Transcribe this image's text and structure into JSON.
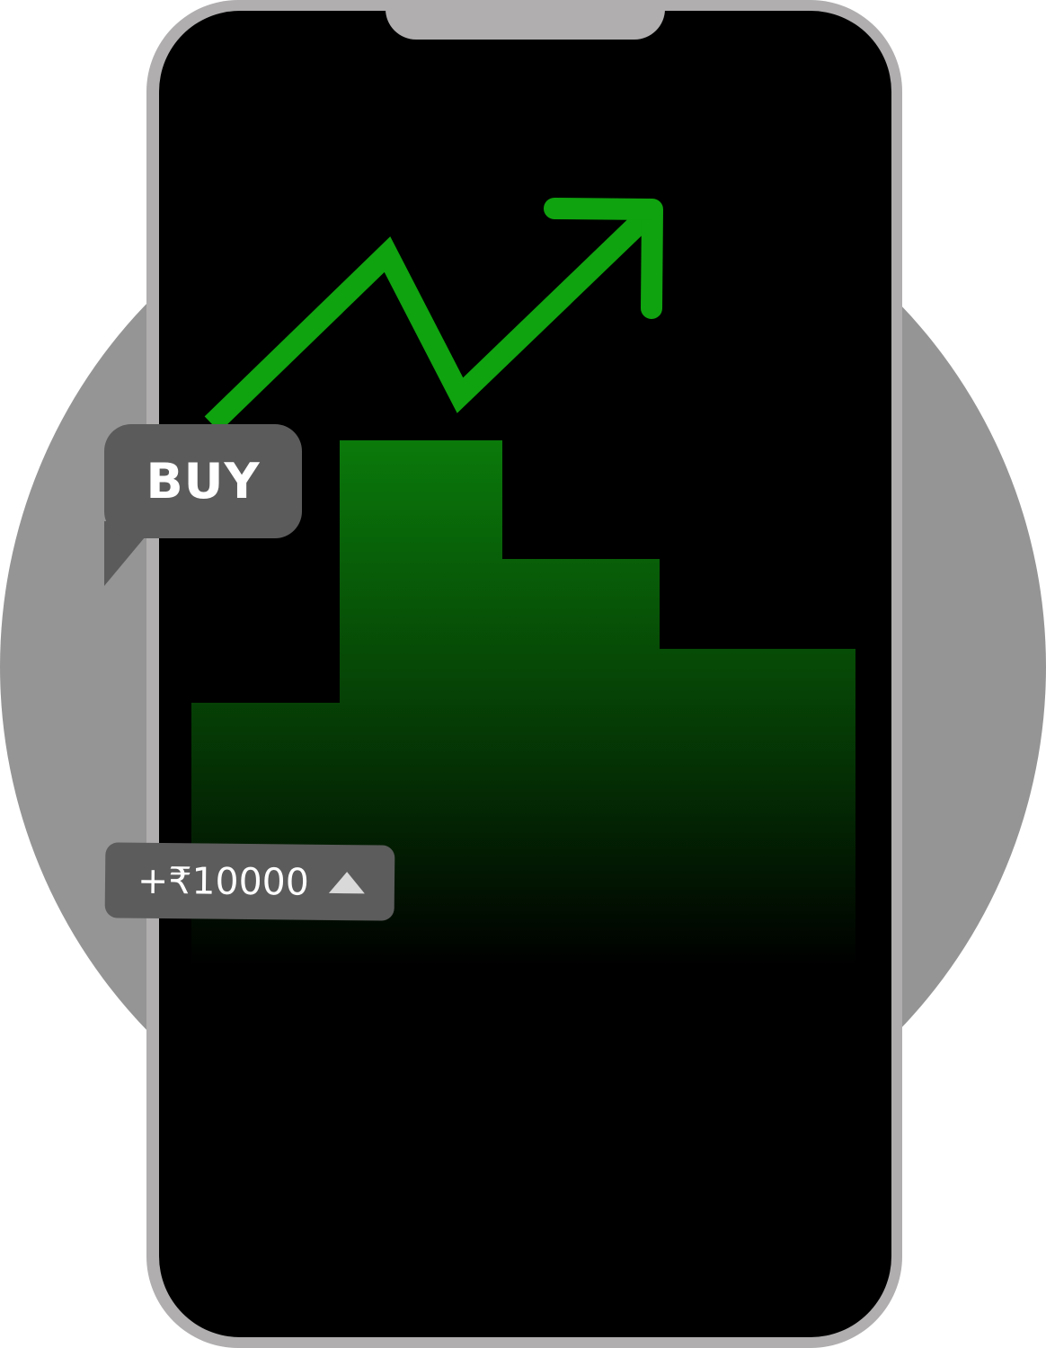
{
  "colors": {
    "background_circle": "#969595",
    "phone_frame": "#b0aeae",
    "screen": "#000000",
    "trend_line": "#0fa30f",
    "bars_top": "#0a7a0a",
    "badge": "#5b5b5b"
  },
  "buy_badge": {
    "label": "BUY"
  },
  "gain_badge": {
    "value": "+₹10000",
    "direction_icon": "triangle-up-icon"
  },
  "trend_icon": "trend-up-arrow-icon"
}
